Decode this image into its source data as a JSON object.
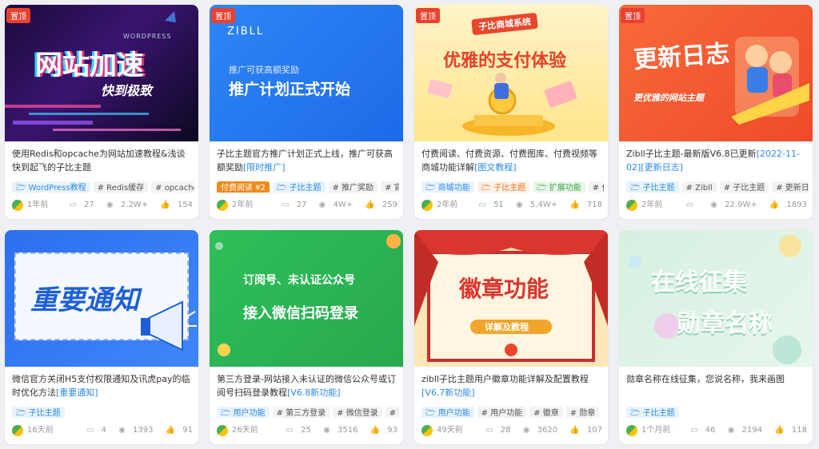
{
  "pin_label": "置顶",
  "cards": [
    {
      "thumb": {
        "line1": "网站加速",
        "line2": "快到极致",
        "small": "WORDPRESS"
      },
      "title": "使用Redis和opcache为网站加速教程&浅谈快到起飞的子比主题",
      "title_hl": "",
      "tags": [
        {
          "t": "🗁 WordPress教程",
          "c": "blue"
        },
        {
          "t": "# Redis缓存",
          "c": ""
        },
        {
          "t": "# opcache",
          "c": ""
        }
      ],
      "time": "1年前",
      "comments": "27",
      "views": "2.2W+",
      "likes": "154"
    },
    {
      "thumb": {
        "logo": "ZIBLL",
        "line1": "推广可获高额奖励",
        "line2": "推广计划正式开始"
      },
      "title": "子比主题官方推广计划正式上线，推广可获高额奖励",
      "title_hl": "[限时推广]",
      "tags": [
        {
          "t": "付费阅读 ¥2",
          "c": "pay"
        },
        {
          "t": "🗁 子比主题",
          "c": "blue"
        },
        {
          "t": "# 推广奖励",
          "c": ""
        },
        {
          "t": "# 官",
          "c": ""
        }
      ],
      "time": "2年前",
      "comments": "27",
      "views": "4W+",
      "likes": "259"
    },
    {
      "thumb": {
        "line1": "子比商城系统",
        "line2": "优雅的支付体验"
      },
      "title": "付费阅读、付费资源、付费图库、付费视频等商城功能详解",
      "title_hl": "[图文教程]",
      "tags": [
        {
          "t": "🗁 商城功能",
          "c": "blue"
        },
        {
          "t": "🗁 子比主题",
          "c": "orange"
        },
        {
          "t": "🗁 扩展功能",
          "c": "green"
        },
        {
          "t": "# 付",
          "c": ""
        }
      ],
      "time": "2年前",
      "comments": "51",
      "views": "5.4W+",
      "likes": "718"
    },
    {
      "thumb": {
        "line1": "更新日志",
        "line2": "更优雅的网站主题"
      },
      "title": "Zibll子比主题-最新版V6.8已更新",
      "title_hl": "[2022-11-02][更新日志]",
      "tags": [
        {
          "t": "🗁 子比主题",
          "c": "blue"
        },
        {
          "t": "# Zibll",
          "c": ""
        },
        {
          "t": "# 子比主题",
          "c": ""
        },
        {
          "t": "# 更新日志",
          "c": ""
        }
      ],
      "time": "2年前",
      "comments": "",
      "views": "22.9W+",
      "likes": "1893"
    },
    {
      "thumb": {
        "line1": "重要通知"
      },
      "title": "微信官方关闭H5支付权限通知及讯虎pay的临时优化方法",
      "title_hl": "[重要通知]",
      "tags": [
        {
          "t": "🗁 子比主题",
          "c": "blue"
        }
      ],
      "time": "16天前",
      "comments": "4",
      "views": "1393",
      "likes": "91"
    },
    {
      "thumb": {
        "line1": "订阅号、未认证公众号",
        "line2": "接入微信扫码登录"
      },
      "title": "第三方登录-网站接入未认证的微信公众号或订阅号扫码登录教程",
      "title_hl": "[V6.8新功能]",
      "tags": [
        {
          "t": "🗁 用户功能",
          "c": "blue"
        },
        {
          "t": "# 第三方登录",
          "c": ""
        },
        {
          "t": "# 微信登录",
          "c": ""
        },
        {
          "t": "# 扫",
          "c": ""
        }
      ],
      "time": "26天前",
      "comments": "25",
      "views": "3516",
      "likes": "93"
    },
    {
      "thumb": {
        "line1": "徽章功能",
        "line2": "详解及教程"
      },
      "title": "zibll子比主题用户徽章功能详解及配置教程",
      "title_hl": "[V6.7新功能]",
      "tags": [
        {
          "t": "🗁 用户功能",
          "c": "blue"
        },
        {
          "t": "# 用户功能",
          "c": ""
        },
        {
          "t": "# 徽章",
          "c": ""
        },
        {
          "t": "# 勋章",
          "c": ""
        }
      ],
      "time": "49天前",
      "comments": "28",
      "views": "3620",
      "likes": "107"
    },
    {
      "thumb": {
        "line1": "在线征集",
        "line2": "勋章名称"
      },
      "title": "勋章名称在线征集，您说名称，我来画图",
      "title_hl": "",
      "tags": [
        {
          "t": "🗁 子比主题",
          "c": "blue"
        }
      ],
      "time": "1个月前",
      "comments": "46",
      "views": "2194",
      "likes": "118"
    }
  ]
}
